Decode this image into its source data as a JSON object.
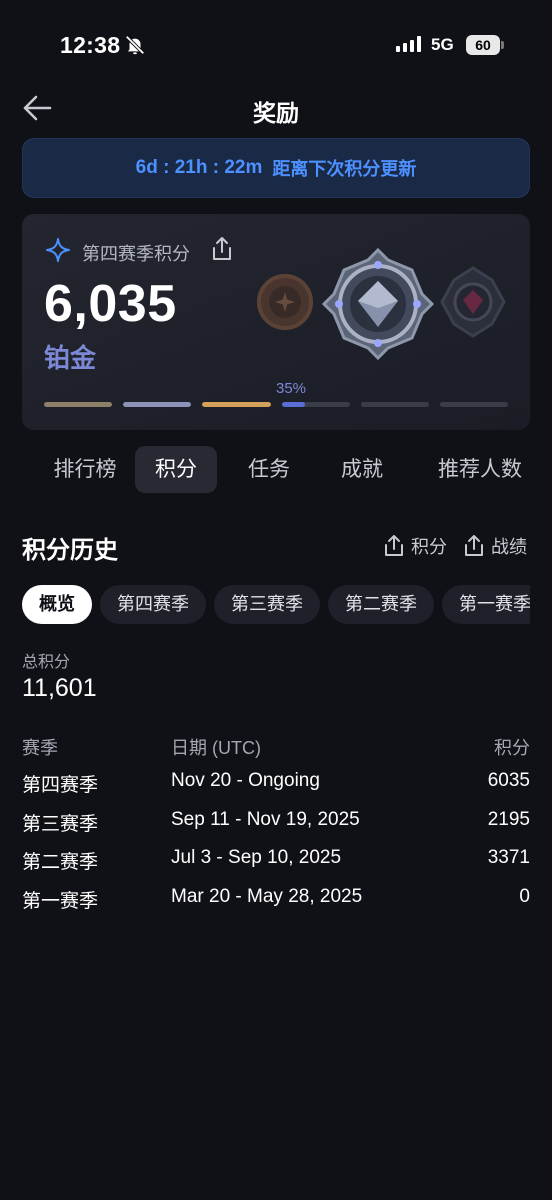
{
  "status_bar": {
    "time": "12:38",
    "network": "5G",
    "battery": "60"
  },
  "header": {
    "title": "奖励"
  },
  "timer": {
    "value": "6d : 21h : 22m",
    "text": "距离下次积分更新"
  },
  "score_card": {
    "season_label": "第四赛季积分",
    "score": "6,035",
    "tier": "铂金",
    "progress_label": "35%",
    "progress": 0.35,
    "segments": [
      {
        "color": "#8e7f68",
        "fill": 1
      },
      {
        "color": "#8d93b8",
        "fill": 1
      },
      {
        "color": "#d3a15a",
        "fill": 1
      },
      {
        "color": "#5b6ed6",
        "fill": 0.35
      },
      {
        "color": "#3a3c48",
        "fill": 0
      },
      {
        "color": "#3a3c48",
        "fill": 0
      }
    ]
  },
  "tabs": [
    {
      "label": "排行榜"
    },
    {
      "label": "积分"
    },
    {
      "label": "任务"
    },
    {
      "label": "成就"
    },
    {
      "label": "推荐人数"
    }
  ],
  "history": {
    "title": "积分历史",
    "export_points": "积分",
    "export_record": "战绩"
  },
  "filters": [
    "概览",
    "第四赛季",
    "第三赛季",
    "第二赛季",
    "第一赛季"
  ],
  "total": {
    "label": "总积分",
    "value": "11,601"
  },
  "table": {
    "headers": [
      "赛季",
      "日期 (UTC)",
      "积分"
    ],
    "rows": [
      [
        "第四赛季",
        "Nov 20 - Ongoing",
        "6035"
      ],
      [
        "第三赛季",
        "Sep 11 - Nov 19, 2025",
        "2195"
      ],
      [
        "第二赛季",
        "Jul 3 - Sep 10, 2025",
        "3371"
      ],
      [
        "第一赛季",
        "Mar 20 - May 28, 2025",
        "0"
      ]
    ]
  },
  "colors": {
    "accent": "#4d90ff",
    "tier": "#7c88d6",
    "background": "#101117"
  }
}
